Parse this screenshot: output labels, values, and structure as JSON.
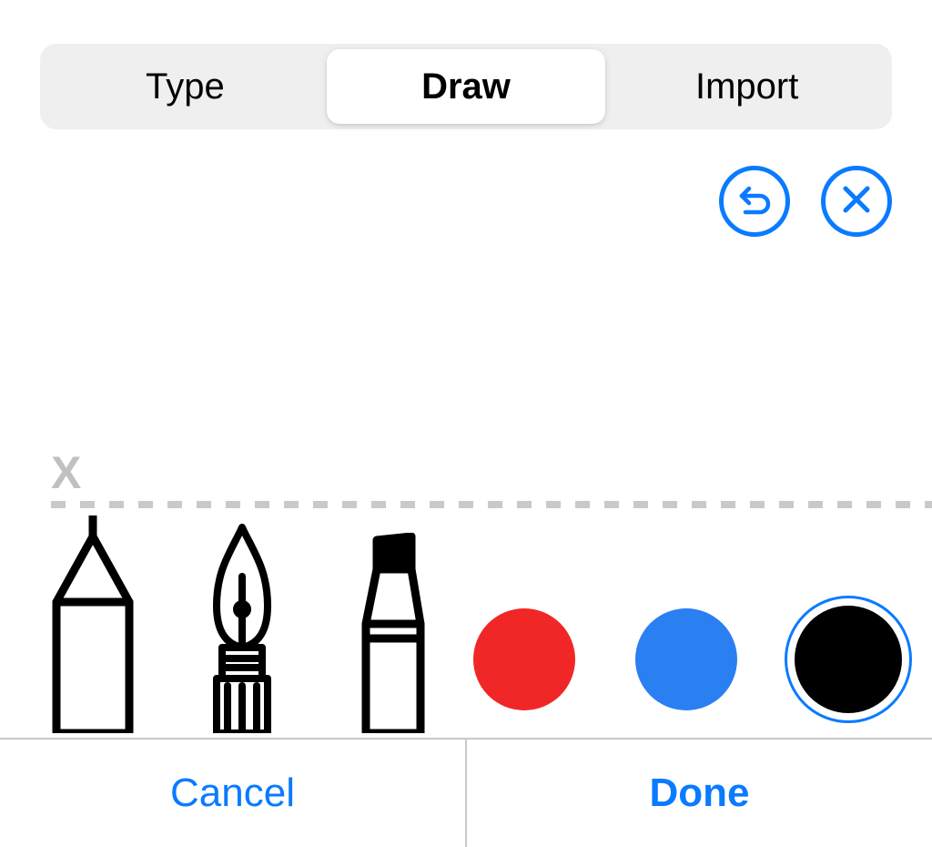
{
  "tabs": {
    "type": "Type",
    "draw": "Draw",
    "import": "Import",
    "selected": "draw"
  },
  "actions": {
    "undo": "undo",
    "clear": "clear"
  },
  "guide": {
    "baseline_marker": "X"
  },
  "pens": [
    {
      "name": "pencil"
    },
    {
      "name": "fountain-pen"
    },
    {
      "name": "marker"
    }
  ],
  "colors": [
    {
      "name": "red",
      "hex": "#f12727",
      "selected": false
    },
    {
      "name": "blue",
      "hex": "#2a7ff1",
      "selected": false
    },
    {
      "name": "black",
      "hex": "#000000",
      "selected": true
    }
  ],
  "buttons": {
    "cancel": "Cancel",
    "done": "Done"
  },
  "accent_color": "#0a7bff"
}
